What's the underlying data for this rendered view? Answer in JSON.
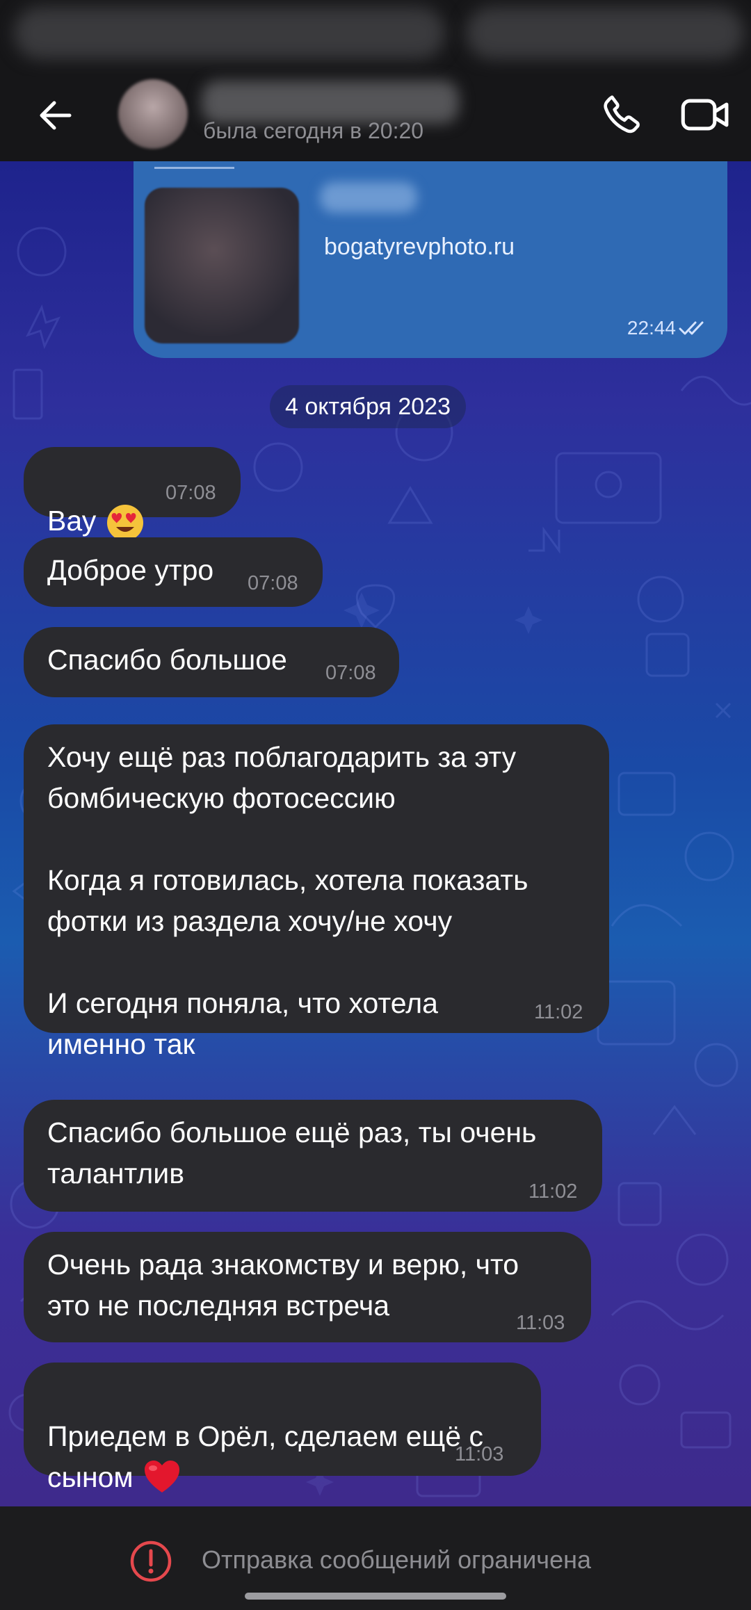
{
  "header": {
    "last_seen": "была сегодня в 20:20"
  },
  "link_preview": {
    "domain": "bogatyrevphoto.ru",
    "time": "22:44"
  },
  "date_separator": "4 октября 2023",
  "messages": [
    {
      "text": "Вау",
      "time": "07:08",
      "emoji": "heart-eyes"
    },
    {
      "text": "Доброе утро",
      "time": "07:08"
    },
    {
      "text": "Спасибо большое",
      "time": "07:08"
    },
    {
      "text": "Хочу ещё раз поблагодарить за эту\nбомбическую фотосессию\n\nКогда я готовилась, хотела показать\nфотки из раздела хочу/не хочу\n\nИ сегодня поняла, что хотела\nименно так",
      "time": "11:02"
    },
    {
      "text": "Спасибо большое ещё раз, ты очень\nталантлив",
      "time": "11:02"
    },
    {
      "text": "Очень рада знакомству и верю, что\nэто не последняя встреча",
      "time": "11:03"
    },
    {
      "text": "Приедем в Орёл, сделаем ещё с\nсыном",
      "time": "11:03",
      "emoji": "red-heart"
    }
  ],
  "bottom_bar": {
    "notice": "Отправка сообщений ограничена"
  },
  "colors": {
    "incoming_bubble": "#2a2a2e",
    "outgoing_bubble": "#2f6ab4",
    "restriction_icon": "#e5484d"
  }
}
